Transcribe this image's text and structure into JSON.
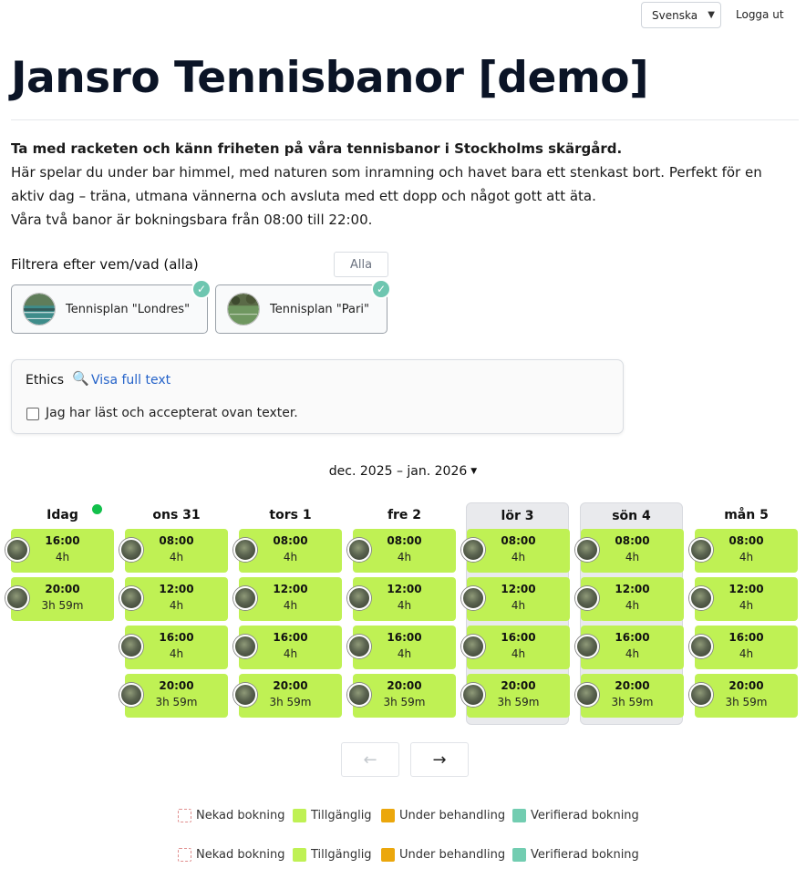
{
  "header": {
    "language": "Svenska",
    "logout": "Logga ut"
  },
  "title": "Jansro Tennisbanor [demo]",
  "intro": {
    "lead": "Ta med racketen och känn friheten på våra tennisbanor i Stockholms skärgård.",
    "line1": "Här spelar du under bar himmel, med naturen som inramning och havet bara ett stenkast bort. Perfekt för en aktiv dag – träna, utmana vännerna och avsluta med ett dopp och något gott att äta.",
    "line2": "Våra två banor är bokningsbara från 08:00 till 22:00."
  },
  "filter": {
    "label": "Filtrera efter vem/vad (alla)",
    "all_button": "Alla",
    "courts": [
      {
        "name": "Tennisplan \"Londres\"",
        "selected": true
      },
      {
        "name": "Tennisplan \"Pari\"",
        "selected": true
      }
    ]
  },
  "ethics": {
    "title": "Ethics",
    "link": "Visa full text",
    "checkbox_label": "Jag har läst och accepterat ovan texter.",
    "checked": false
  },
  "calendar": {
    "range": "dec. 2025 – jan. 2026",
    "days": [
      {
        "label": "Idag",
        "today": true,
        "weekend": false,
        "slots": [
          {
            "time": "16:00",
            "dur": "4h"
          },
          {
            "time": "20:00",
            "dur": "3h 59m"
          }
        ]
      },
      {
        "label": "ons 31",
        "today": false,
        "weekend": false,
        "slots": [
          {
            "time": "08:00",
            "dur": "4h"
          },
          {
            "time": "12:00",
            "dur": "4h"
          },
          {
            "time": "16:00",
            "dur": "4h"
          },
          {
            "time": "20:00",
            "dur": "3h 59m"
          }
        ]
      },
      {
        "label": "tors 1",
        "today": false,
        "weekend": false,
        "slots": [
          {
            "time": "08:00",
            "dur": "4h"
          },
          {
            "time": "12:00",
            "dur": "4h"
          },
          {
            "time": "16:00",
            "dur": "4h"
          },
          {
            "time": "20:00",
            "dur": "3h 59m"
          }
        ]
      },
      {
        "label": "fre 2",
        "today": false,
        "weekend": false,
        "slots": [
          {
            "time": "08:00",
            "dur": "4h"
          },
          {
            "time": "12:00",
            "dur": "4h"
          },
          {
            "time": "16:00",
            "dur": "4h"
          },
          {
            "time": "20:00",
            "dur": "3h 59m"
          }
        ]
      },
      {
        "label": "lör 3",
        "today": false,
        "weekend": true,
        "slots": [
          {
            "time": "08:00",
            "dur": "4h"
          },
          {
            "time": "12:00",
            "dur": "4h"
          },
          {
            "time": "16:00",
            "dur": "4h"
          },
          {
            "time": "20:00",
            "dur": "3h 59m"
          }
        ]
      },
      {
        "label": "sön 4",
        "today": false,
        "weekend": true,
        "slots": [
          {
            "time": "08:00",
            "dur": "4h"
          },
          {
            "time": "12:00",
            "dur": "4h"
          },
          {
            "time": "16:00",
            "dur": "4h"
          },
          {
            "time": "20:00",
            "dur": "3h 59m"
          }
        ]
      },
      {
        "label": "mån 5",
        "today": false,
        "weekend": false,
        "slots": [
          {
            "time": "08:00",
            "dur": "4h"
          },
          {
            "time": "12:00",
            "dur": "4h"
          },
          {
            "time": "16:00",
            "dur": "4h"
          },
          {
            "time": "20:00",
            "dur": "3h 59m"
          }
        ]
      }
    ],
    "prev": "←",
    "next": "→"
  },
  "legend": [
    {
      "denied": "Nekad bokning",
      "available": "Tillgänglig",
      "pending": "Under behandling",
      "verified": "Verifierad bokning"
    },
    {
      "denied": "Nekad bokning",
      "available": "Tillgänglig",
      "pending": "Under behandling",
      "verified": "Verifierad bokning"
    }
  ],
  "colors": {
    "available": "#bff154",
    "pending": "#eba70c",
    "verified": "#72cdb1",
    "denied_border": "#e08f8f",
    "link": "#2563c9",
    "today_dot": "#12c04b"
  }
}
